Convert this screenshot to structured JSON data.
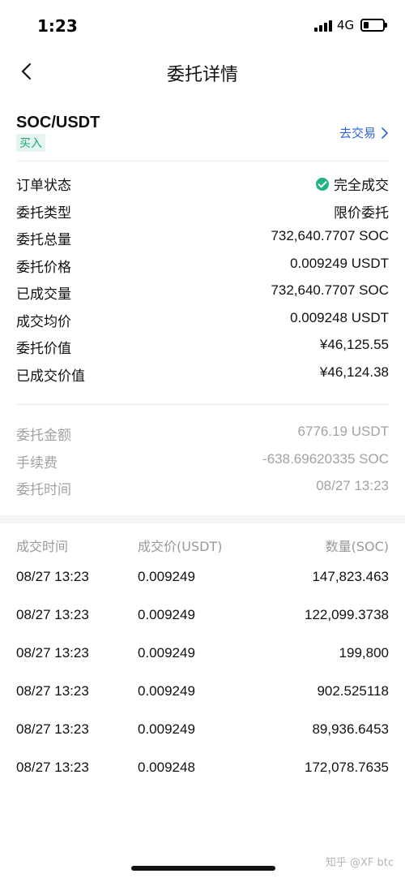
{
  "status_bar": {
    "time": "1:23",
    "network": "4G"
  },
  "nav": {
    "title": "委托详情"
  },
  "pair": {
    "name": "SOC/USDT",
    "side": "买入",
    "go_trade": "去交易"
  },
  "info": [
    {
      "label": "订单状态",
      "value": "完全成交"
    },
    {
      "label": "委托类型",
      "value": "限价委托"
    },
    {
      "label": "委托总量",
      "value": "732,640.7707 SOC"
    },
    {
      "label": "委托价格",
      "value": "0.009249 USDT"
    },
    {
      "label": "已成交量",
      "value": "732,640.7707 SOC"
    },
    {
      "label": "成交均价",
      "value": "0.009248 USDT"
    },
    {
      "label": "委托价值",
      "value": "¥46,125.55"
    },
    {
      "label": "已成交价值",
      "value": "¥46,124.38"
    }
  ],
  "fees": [
    {
      "label": "委托金额",
      "value": "6776.19 USDT"
    },
    {
      "label": "手续费",
      "value": "-638.69620335 SOC"
    },
    {
      "label": "委托时间",
      "value": "08/27 13:23"
    }
  ],
  "trades": {
    "headers": [
      "成交时间",
      "成交价(USDT)",
      "数量(SOC)"
    ],
    "rows": [
      [
        "08/27 13:23",
        "0.009249",
        "147,823.463"
      ],
      [
        "08/27 13:23",
        "0.009249",
        "122,099.3738"
      ],
      [
        "08/27 13:23",
        "0.009249",
        "199,800"
      ],
      [
        "08/27 13:23",
        "0.009249",
        "902.525118"
      ],
      [
        "08/27 13:23",
        "0.009249",
        "89,936.6453"
      ],
      [
        "08/27 13:23",
        "0.009248",
        "172,078.7635"
      ]
    ]
  },
  "watermark": "知乎 @XF btc",
  "colors": {
    "buy_green": "#1aa97a",
    "link_blue": "#2a64d8",
    "muted": "#a2a2a2"
  },
  "icons": {
    "back": "chevron-left-icon",
    "status": "check-circle-icon",
    "go_trade": "chevron-right-icon"
  }
}
